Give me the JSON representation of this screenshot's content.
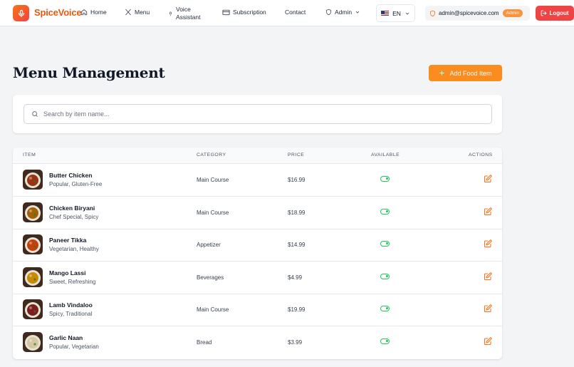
{
  "app": {
    "name": "SpiceVoice"
  },
  "nav": {
    "home": "Home",
    "menu": "Menu",
    "voice_line1": "Voice",
    "voice_line2": "Assistant",
    "subscription": "Subscription",
    "contact": "Contact",
    "admin": "Admin"
  },
  "language": {
    "code": "EN"
  },
  "user": {
    "email": "admin@spicevoice.com",
    "role_badge": "Admin"
  },
  "logout_label": "Logout",
  "page": {
    "title": "Menu Management",
    "add_button": "Add Food Item"
  },
  "search": {
    "placeholder": "Search by item name...",
    "value": ""
  },
  "table": {
    "headers": {
      "item": "ITEM",
      "category": "CATEGORY",
      "price": "PRICE",
      "available": "AVAILABLE",
      "actions": "ACTIONS"
    },
    "rows": [
      {
        "name": "Butter Chicken",
        "tags": "Popular, Gluten-Free",
        "category": "Main Course",
        "price": "$16.99",
        "available": true,
        "thumb_color": "#9a3412"
      },
      {
        "name": "Chicken Biryani",
        "tags": "Chef Special, Spicy",
        "category": "Main Course",
        "price": "$18.99",
        "available": true,
        "thumb_color": "#a16207"
      },
      {
        "name": "Paneer Tikka",
        "tags": "Vegetarian, Healthy",
        "category": "Appetizer",
        "price": "$14.99",
        "available": true,
        "thumb_color": "#c2410c"
      },
      {
        "name": "Mango Lassi",
        "tags": "Sweet, Refreshing",
        "category": "Beverages",
        "price": "$4.99",
        "available": true,
        "thumb_color": "#ca8a04"
      },
      {
        "name": "Lamb Vindaloo",
        "tags": "Spicy, Traditional",
        "category": "Main Course",
        "price": "$19.99",
        "available": true,
        "thumb_color": "#7f1d1d"
      },
      {
        "name": "Garlic Naan",
        "tags": "Popular, Vegetarian",
        "category": "Bread",
        "price": "$3.99",
        "available": true,
        "thumb_color": "#d6c7a1"
      }
    ]
  },
  "colors": {
    "brand": "#ea580c",
    "accent": "#fb8c1f",
    "danger": "#ef4444",
    "success": "#22c55e"
  },
  "icons": [
    "microphone-icon",
    "home-icon",
    "utensils-icon",
    "microphone-small-icon",
    "credit-card-icon",
    "shield-icon",
    "chevron-down-icon",
    "flag-us-icon",
    "logout-icon",
    "plus-icon",
    "search-icon",
    "toggle-on-icon",
    "edit-icon"
  ]
}
